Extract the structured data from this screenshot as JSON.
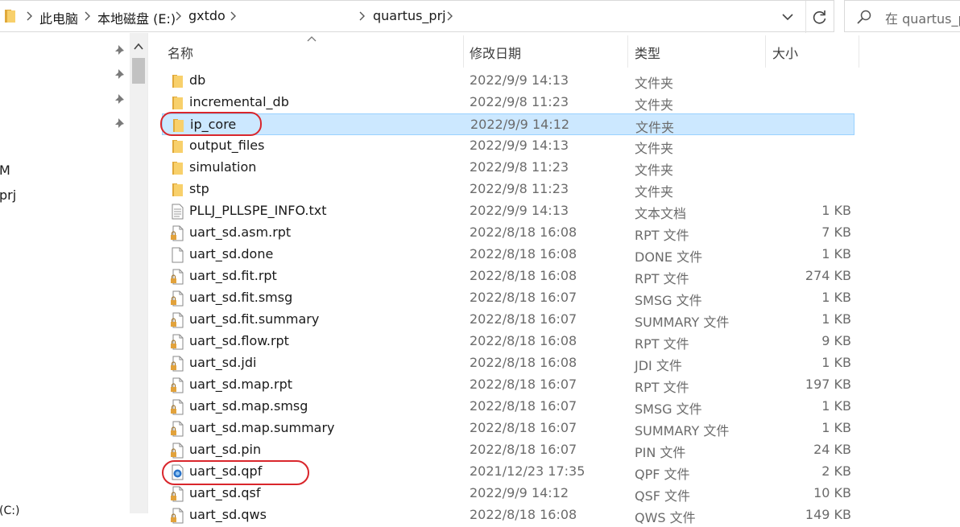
{
  "address_bar": {
    "crumbs": [
      "此电脑",
      "本地磁盘 (E:)",
      "gxtdo",
      "quartus_prj"
    ]
  },
  "search": {
    "placeholder": "在 quartus_p"
  },
  "nav_pane": {
    "fragments": [
      "M",
      "prj",
      "(C:)"
    ]
  },
  "columns": {
    "name": "名称",
    "date": "修改日期",
    "type": "类型",
    "size": "大小"
  },
  "files": [
    {
      "name": "db",
      "date": "2022/9/9 14:13",
      "type": "文件夹",
      "size": "",
      "icon": "folder-icon"
    },
    {
      "name": "incremental_db",
      "date": "2022/9/8 11:23",
      "type": "文件夹",
      "size": "",
      "icon": "folder-icon"
    },
    {
      "name": "ip_core",
      "date": "2022/9/9 14:12",
      "type": "文件夹",
      "size": "",
      "icon": "folder-icon",
      "selected": true
    },
    {
      "name": "output_files",
      "date": "2022/9/9 14:13",
      "type": "文件夹",
      "size": "",
      "icon": "folder-icon"
    },
    {
      "name": "simulation",
      "date": "2022/9/8 11:23",
      "type": "文件夹",
      "size": "",
      "icon": "folder-icon"
    },
    {
      "name": "stp",
      "date": "2022/9/8 11:23",
      "type": "文件夹",
      "size": "",
      "icon": "folder-icon"
    },
    {
      "name": "PLLJ_PLLSPE_INFO.txt",
      "date": "2022/9/9 14:13",
      "type": "文本文档",
      "size": "1 KB",
      "icon": "text-file-icon"
    },
    {
      "name": "uart_sd.asm.rpt",
      "date": "2022/8/18 16:08",
      "type": "RPT 文件",
      "size": "7 KB",
      "icon": "locked-file-icon"
    },
    {
      "name": "uart_sd.done",
      "date": "2022/8/18 16:08",
      "type": "DONE 文件",
      "size": "1 KB",
      "icon": "file-icon"
    },
    {
      "name": "uart_sd.fit.rpt",
      "date": "2022/8/18 16:08",
      "type": "RPT 文件",
      "size": "274 KB",
      "icon": "locked-file-icon"
    },
    {
      "name": "uart_sd.fit.smsg",
      "date": "2022/8/18 16:07",
      "type": "SMSG 文件",
      "size": "1 KB",
      "icon": "locked-file-icon"
    },
    {
      "name": "uart_sd.fit.summary",
      "date": "2022/8/18 16:07",
      "type": "SUMMARY 文件",
      "size": "1 KB",
      "icon": "locked-file-icon"
    },
    {
      "name": "uart_sd.flow.rpt",
      "date": "2022/8/18 16:08",
      "type": "RPT 文件",
      "size": "9 KB",
      "icon": "locked-file-icon"
    },
    {
      "name": "uart_sd.jdi",
      "date": "2022/8/18 16:08",
      "type": "JDI 文件",
      "size": "1 KB",
      "icon": "locked-file-icon"
    },
    {
      "name": "uart_sd.map.rpt",
      "date": "2022/8/18 16:07",
      "type": "RPT 文件",
      "size": "197 KB",
      "icon": "locked-file-icon"
    },
    {
      "name": "uart_sd.map.smsg",
      "date": "2022/8/18 16:07",
      "type": "SMSG 文件",
      "size": "1 KB",
      "icon": "locked-file-icon"
    },
    {
      "name": "uart_sd.map.summary",
      "date": "2022/8/18 16:07",
      "type": "SUMMARY 文件",
      "size": "1 KB",
      "icon": "locked-file-icon"
    },
    {
      "name": "uart_sd.pin",
      "date": "2022/8/18 16:07",
      "type": "PIN 文件",
      "size": "24 KB",
      "icon": "locked-file-icon"
    },
    {
      "name": "uart_sd.qpf",
      "date": "2021/12/23 17:35",
      "type": "QPF 文件",
      "size": "2 KB",
      "icon": "quartus-project-icon"
    },
    {
      "name": "uart_sd.qsf",
      "date": "2022/9/9 14:12",
      "type": "QSF 文件",
      "size": "10 KB",
      "icon": "locked-file-icon"
    },
    {
      "name": "uart_sd.qws",
      "date": "2022/8/18 16:08",
      "type": "QWS 文件",
      "size": "149 KB",
      "icon": "locked-file-icon"
    }
  ],
  "colors": {
    "selection_bg": "#cce8ff",
    "selection_border": "#99d1ff",
    "annotation": "#d9262c",
    "folder": "#f8d06b"
  }
}
